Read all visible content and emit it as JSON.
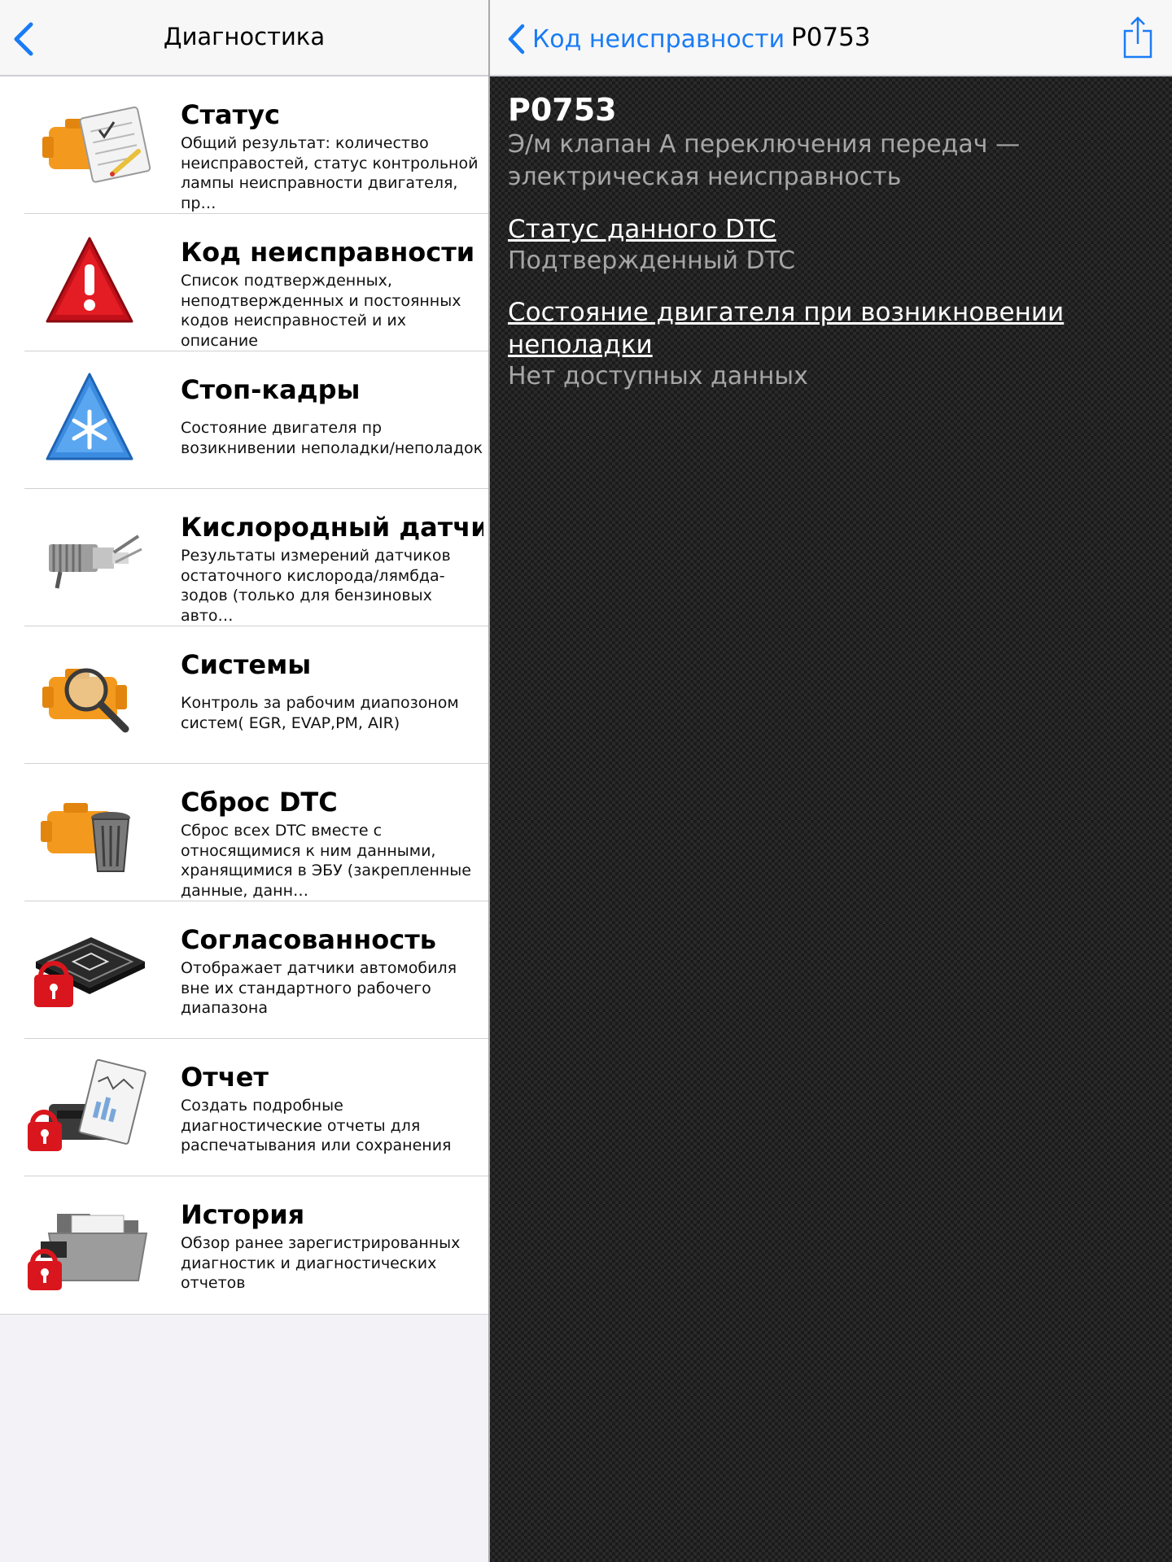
{
  "master": {
    "title": "Диагностика",
    "items": [
      {
        "title": "Статус",
        "desc": "Общий результат: количество неисправостей, статус контрольной лампы неисправности двигателя, пр…",
        "icon": "engine-checklist-icon"
      },
      {
        "title": "Код неисправности",
        "desc": "Список подтвержденных, неподтвержденных и постоянных кодов неисправностей и их описание",
        "icon": "warning-triangle-icon"
      },
      {
        "title": "Стоп-кадры",
        "desc": "Состояние двигателя пр возикнивении неполадки/неполадок",
        "icon": "snowflake-triangle-icon"
      },
      {
        "title": "Кислородный датчи",
        "desc": "Результаты измерений датчиков остаточного кислорода/лямбда-зодов (только для бензиновых авто…",
        "icon": "oxygen-sensor-icon"
      },
      {
        "title": "Системы",
        "desc": "Контроль за рабочим диапозоном систем( EGR, EVAP,PM, AIR)",
        "icon": "engine-magnifier-icon"
      },
      {
        "title": "Сброс DTC",
        "desc": "Сброс всех DTC вместе с относящимися к ним данными, хранящимися в ЭБУ (закрепленные данные, данн…",
        "icon": "engine-trash-icon"
      },
      {
        "title": "Согласованность",
        "desc": "Отображает датчики автомобиля вне их стандартного рабочего диапазона",
        "icon": "chip-lock-icon"
      },
      {
        "title": "Отчет",
        "desc": "Создать подробные диагностические отчеты для распечатывания или сохранения",
        "icon": "printer-report-lock-icon"
      },
      {
        "title": "История",
        "desc": "Обзор ранее зарегистрированных диагностик и диагностических отчетов",
        "icon": "folder-lock-icon"
      }
    ]
  },
  "detail": {
    "back_label": "Код неисправности",
    "title": "P0753",
    "code": "P0753",
    "code_desc": "Э/м клапан А переключения передач — электрическая неисправность",
    "status_head": "Статус данного DTC",
    "status_val": "Подтвержденный DTC",
    "freeze_head": "Состояние двигателя при возникновении неполадки",
    "freeze_val": "Нет доступных данных"
  },
  "colors": {
    "accent": "#1a7cf4",
    "engine": "#f39a1e",
    "lock": "#d9161d"
  }
}
